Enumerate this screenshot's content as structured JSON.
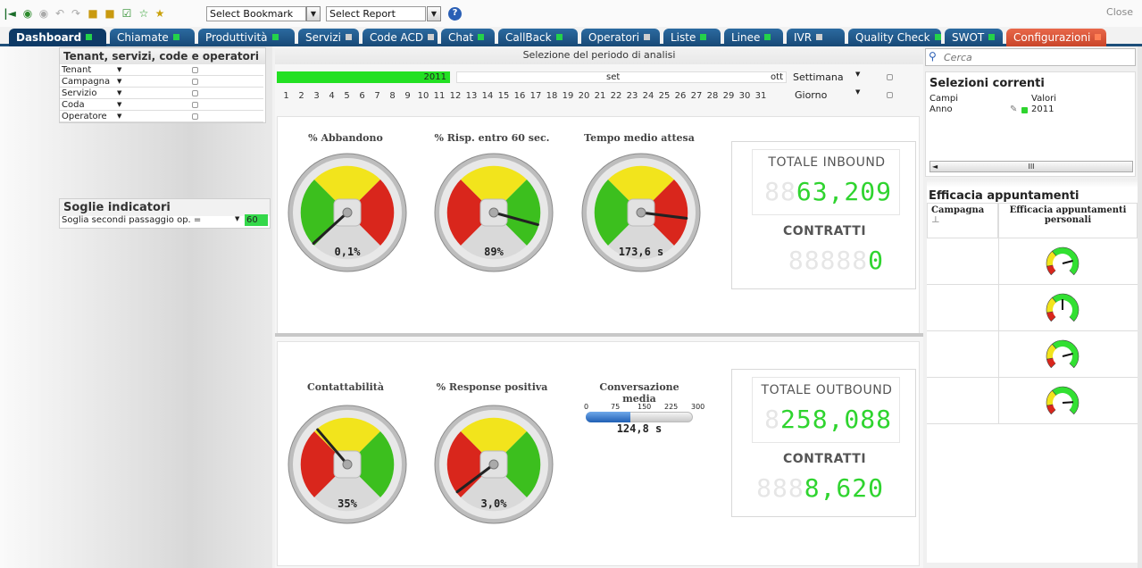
{
  "toolbar": {
    "bookmark_select": "Select Bookmark",
    "report_select": "Select Report",
    "close_label": "Close"
  },
  "tabs": [
    {
      "label": "Dashboard",
      "status": "green"
    },
    {
      "label": "Chiamate",
      "status": "green"
    },
    {
      "label": "Produttività",
      "status": "green"
    },
    {
      "label": "Servizi",
      "status": "grey"
    },
    {
      "label": "Code ACD",
      "status": "grey"
    },
    {
      "label": "Chat",
      "status": "green"
    },
    {
      "label": "CallBack",
      "status": "green"
    },
    {
      "label": "Operatori",
      "status": "grey"
    },
    {
      "label": "Liste",
      "status": "green"
    },
    {
      "label": "Linee",
      "status": "green"
    },
    {
      "label": "IVR",
      "status": "grey"
    },
    {
      "label": "Quality Check",
      "status": "green"
    },
    {
      "label": "SWOT",
      "status": "green"
    },
    {
      "label": "Configurazioni",
      "status": "orange"
    }
  ],
  "filters": {
    "title": "Tenant, servizi, code e operatori",
    "items": [
      "Tenant",
      "Campagna",
      "Servizio",
      "Coda",
      "Operatore"
    ]
  },
  "soglie": {
    "title": "Soglie indicatori",
    "label": "Soglia secondi passaggio op. =",
    "value": "60"
  },
  "period": {
    "title": "Selezione del periodo di analisi",
    "year": "2011",
    "month_selected": "set",
    "month_next": "ott",
    "week_label": "Settimana",
    "day_label": "Giorno",
    "days": [
      "1",
      "2",
      "3",
      "4",
      "5",
      "6",
      "7",
      "8",
      "9",
      "10",
      "11",
      "12",
      "13",
      "14",
      "15",
      "16",
      "17",
      "18",
      "19",
      "20",
      "21",
      "22",
      "23",
      "24",
      "25",
      "26",
      "27",
      "28",
      "29",
      "30",
      "31"
    ]
  },
  "inbound": {
    "gauges": [
      {
        "label": "% Abbandono",
        "value": "0,1%",
        "needle": 0.01,
        "scheme": "gyr"
      },
      {
        "label": "% Risp. entro 60 sec.",
        "value": "89%",
        "needle": 0.89,
        "scheme": "ryg"
      },
      {
        "label": "Tempo medio attesa",
        "value": "173,6 s",
        "needle": 0.86,
        "scheme": "gyr"
      }
    ],
    "total_title": "TOTALE INBOUND",
    "total_value": "63209",
    "total_display": "63,209",
    "contracts_title": "CONTRATTI",
    "contracts_value": "0"
  },
  "outbound": {
    "gauges": [
      {
        "label": "Contattabilità",
        "value": "35%",
        "needle": 0.35,
        "scheme": "ryg"
      },
      {
        "label": "% Response positiva",
        "value": "3,0%",
        "needle": 0.03,
        "scheme": "ryg"
      }
    ],
    "conv_label": "Conversazione media",
    "conv_ticks": [
      "0",
      "75",
      "150",
      "225",
      "300"
    ],
    "conv_value": "124,8 s",
    "conv_level": 0.416,
    "total_title": "TOTALE OUTBOUND",
    "total_value": "258088",
    "total_display": "258,088",
    "contracts_title": "CONTRATTI",
    "contracts_value": "8620",
    "contracts_display": "8,620"
  },
  "right": {
    "search_placeholder": "Cerca",
    "selections_title": "Selezioni correnti",
    "col_fields": "Campi",
    "col_values": "Valori",
    "sel_field": "Anno",
    "sel_value": "2011",
    "scroll_glyph": "III",
    "efficacia_title": "Efficacia appuntamenti",
    "col_campagna": "Campagna",
    "col_efficacia": "Efficacia appuntamenti personali",
    "mini_gauges": [
      0.78,
      0.5,
      0.78,
      0.82
    ]
  },
  "colors": {
    "tab_blue": "#1d4e7a",
    "lcd_green": "#2fd42f",
    "gauge_red": "#d9261c",
    "gauge_yellow": "#f2e41c",
    "gauge_green": "#3cbf1e"
  }
}
